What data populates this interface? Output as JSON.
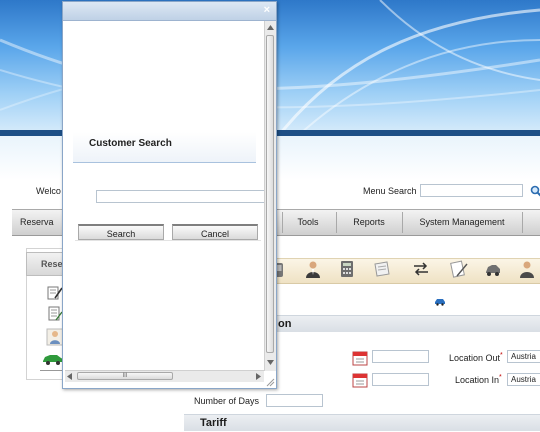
{
  "header": {
    "welcome": "Welco",
    "menu_search_label": "Menu Search",
    "menu_search_value": ""
  },
  "nav": {
    "items": [
      "Reserva",
      "Tools",
      "Reports",
      "System Management"
    ]
  },
  "side_panel": {
    "title": "Rese"
  },
  "form": {
    "section_title": "on",
    "location_out_label": "Location Out",
    "location_out_value": "Austria",
    "location_in_label": "Location In",
    "location_in_value": "Austria",
    "required_marker": "*",
    "number_of_days_label": "Number of Days",
    "number_of_days_value": "",
    "tariff_title": "Tariff"
  },
  "dialog": {
    "close": "×",
    "title": "Customer Search",
    "search_value": "",
    "search_button": "Search",
    "cancel_button": "Cancel",
    "hscroll_grip": "III"
  },
  "colors": {
    "banner": "#4b95dd",
    "nav_bar": "#d9d9d9",
    "icon_bar": "#f3e8cf",
    "required": "#c00000"
  }
}
